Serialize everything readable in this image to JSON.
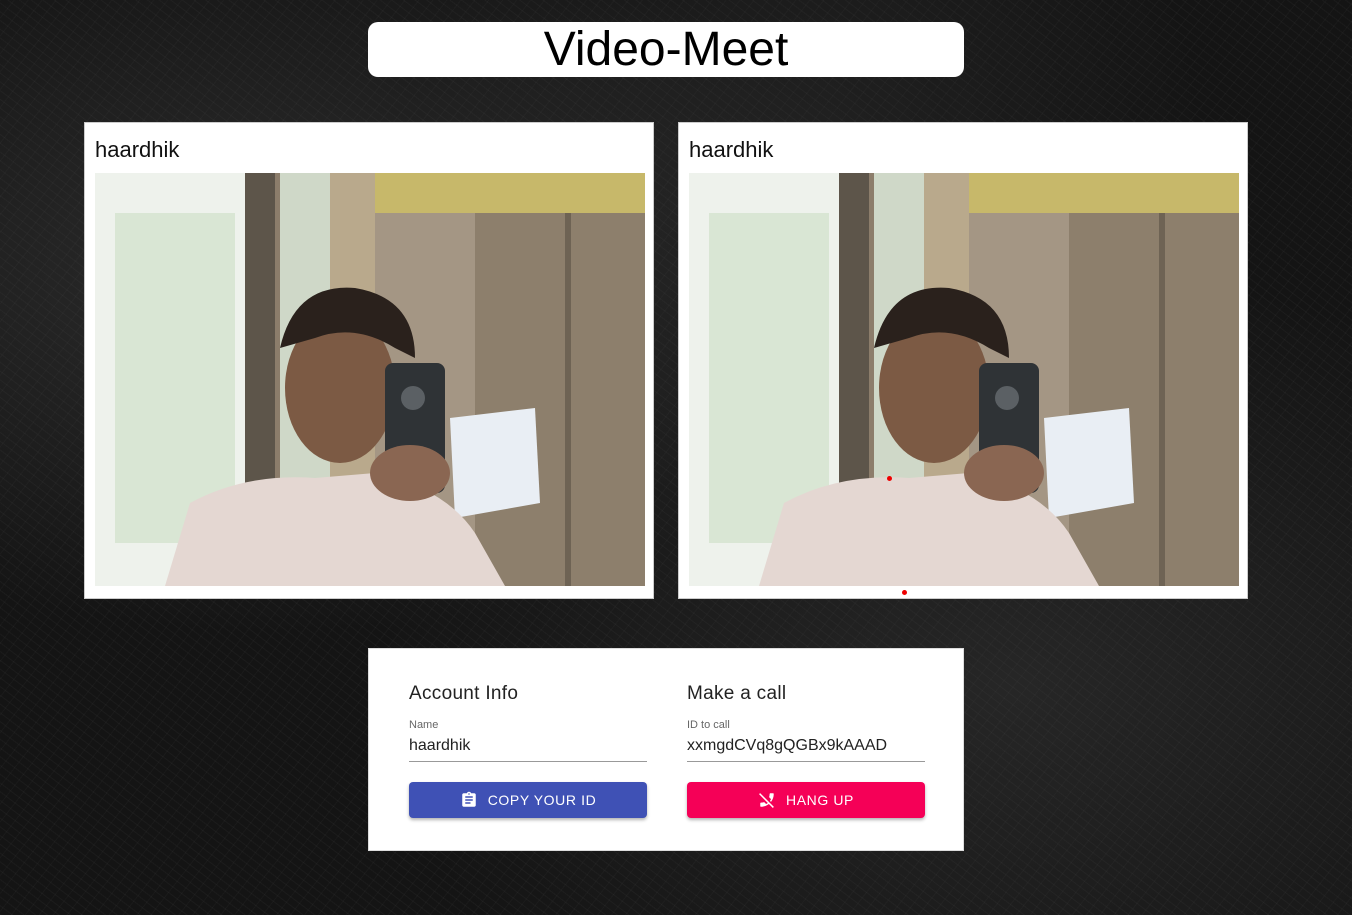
{
  "app": {
    "title": "Video-Meet"
  },
  "videos": [
    {
      "name": "haardhik"
    },
    {
      "name": "haardhik"
    }
  ],
  "account": {
    "heading": "Account Info",
    "name_label": "Name",
    "name_value": "haardhik",
    "copy_button": "COPY YOUR ID",
    "copy_icon": "clipboard-icon"
  },
  "call": {
    "heading": "Make a call",
    "id_label": "ID to call",
    "id_value": "xxmgdCVq8gQGBx9kAAAD",
    "hangup_button": "HANG UP",
    "hangup_icon": "phone-disabled-icon"
  },
  "colors": {
    "copy_button": "#3f51b5",
    "hangup_button": "#f50057"
  }
}
